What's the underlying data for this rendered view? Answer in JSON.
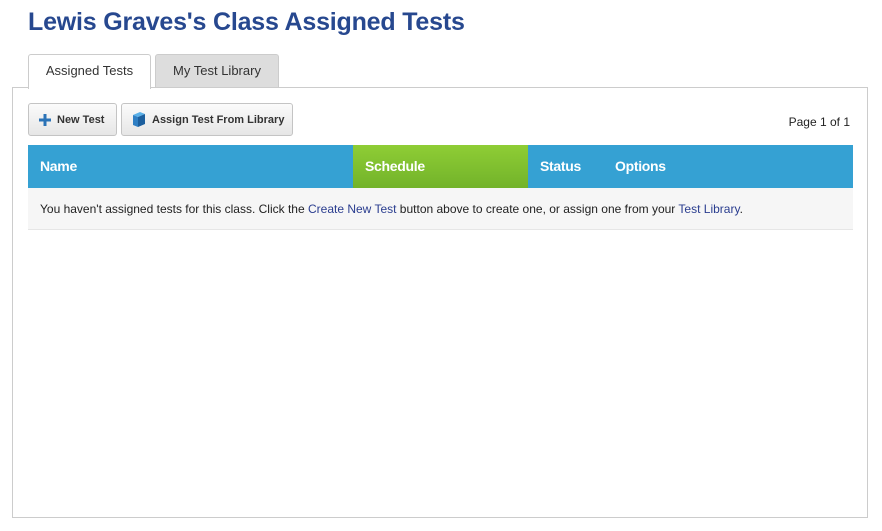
{
  "page": {
    "title": "Lewis Graves's Class Assigned Tests"
  },
  "tabs": [
    {
      "label": "Assigned Tests",
      "active": true
    },
    {
      "label": "My Test Library",
      "active": false
    }
  ],
  "toolbar": {
    "new_test_label": "New Test",
    "new_test_icon": "plus-icon",
    "assign_label": "Assign Test From Library",
    "assign_icon": "book-icon"
  },
  "pagination": {
    "text": "Page 1 of 1"
  },
  "table": {
    "columns": [
      "Name",
      "Schedule",
      "Status",
      "Options"
    ],
    "empty_message": {
      "before": "You haven't assigned tests for this class. Click the ",
      "link1": "Create New Test",
      "middle": " button above to create one, or assign one from your ",
      "link2": "Test Library",
      "after": "."
    }
  },
  "colors": {
    "title": "#27488f",
    "header_blue": "#35a1d3",
    "header_green": "#7dc12f",
    "link": "#2a3d8f"
  }
}
